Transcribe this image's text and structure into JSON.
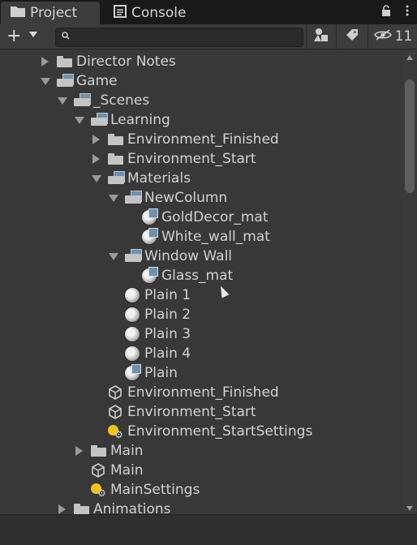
{
  "tabs": [
    {
      "label": "Project",
      "icon": "folder-icon"
    },
    {
      "label": "Console",
      "icon": "console-icon"
    }
  ],
  "tab_actions": {
    "lock_icon": "lock-icon",
    "menu_icon": "kebab-menu-icon"
  },
  "toolbar": {
    "add_label": "+",
    "search_placeholder": "",
    "hidden_count": "11"
  },
  "tree": [
    {
      "label": "Director Notes",
      "icon": "folder-icon",
      "expanded": false
    },
    {
      "label": "Game",
      "icon": "open-folder-icon",
      "expanded": true
    },
    {
      "label": "_Scenes",
      "icon": "open-folder-icon",
      "expanded": true
    },
    {
      "label": "Learning",
      "icon": "open-folder-icon",
      "expanded": true
    },
    {
      "label": "Environment_Finished",
      "icon": "folder-icon",
      "expanded": false
    },
    {
      "label": "Environment_Start",
      "icon": "folder-icon",
      "expanded": false
    },
    {
      "label": "Materials",
      "icon": "open-folder-icon",
      "expanded": true
    },
    {
      "label": "NewColumn",
      "icon": "prefab-folder-icon",
      "expanded": true
    },
    {
      "label": "GoldDecor_mat",
      "icon": "material-icon"
    },
    {
      "label": "White_wall_mat",
      "icon": "material-icon"
    },
    {
      "label": "Window Wall",
      "icon": "prefab-folder-icon",
      "expanded": true
    },
    {
      "label": "Glass_mat",
      "icon": "material-icon"
    },
    {
      "label": "Plain 1",
      "icon": "material-sphere-icon"
    },
    {
      "label": "Plain 2",
      "icon": "material-sphere-icon"
    },
    {
      "label": "Plain 3",
      "icon": "material-sphere-icon"
    },
    {
      "label": "Plain 4",
      "icon": "material-sphere-icon"
    },
    {
      "label": "Plain",
      "icon": "material-icon"
    },
    {
      "label": "Environment_Finished",
      "icon": "unity-scene-icon"
    },
    {
      "label": "Environment_Start",
      "icon": "unity-scene-icon"
    },
    {
      "label": "Environment_StartSettings",
      "icon": "lighting-settings-icon"
    },
    {
      "label": "Main",
      "icon": "folder-icon",
      "expanded": false
    },
    {
      "label": "Main",
      "icon": "unity-scene-icon"
    },
    {
      "label": "MainSettings",
      "icon": "lighting-settings-icon"
    },
    {
      "label": "Animations",
      "icon": "folder-icon",
      "expanded": false
    }
  ]
}
